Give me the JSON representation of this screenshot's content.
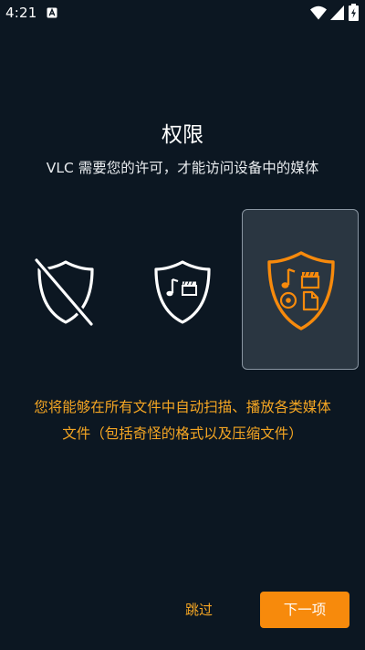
{
  "status_bar": {
    "time": "4:21",
    "notification_icon": "a-box-icon",
    "icons": [
      "wifi-icon",
      "signal-icon",
      "battery-charging-icon"
    ]
  },
  "header": {
    "title": "权限",
    "subtitle": "VLC 需要您的许可，才能访问设备中的媒体"
  },
  "options": [
    {
      "id": "none",
      "icon": "shield-slash-icon",
      "selected": false
    },
    {
      "id": "media",
      "icon": "shield-media-icon",
      "selected": false
    },
    {
      "id": "all_files",
      "icon": "shield-all-files-icon",
      "selected": true
    }
  ],
  "description": {
    "line1": "您将能够在所有文件中自动扫描、播放各类媒体",
    "line2": "文件（包括奇怪的格式以及压缩文件）"
  },
  "actions": {
    "skip_label": "跳过",
    "next_label": "下一项"
  },
  "colors": {
    "background": "#0c1722",
    "accent": "#f78a0c",
    "accent_text": "#f5a623",
    "selected_card": "#2a3641"
  }
}
